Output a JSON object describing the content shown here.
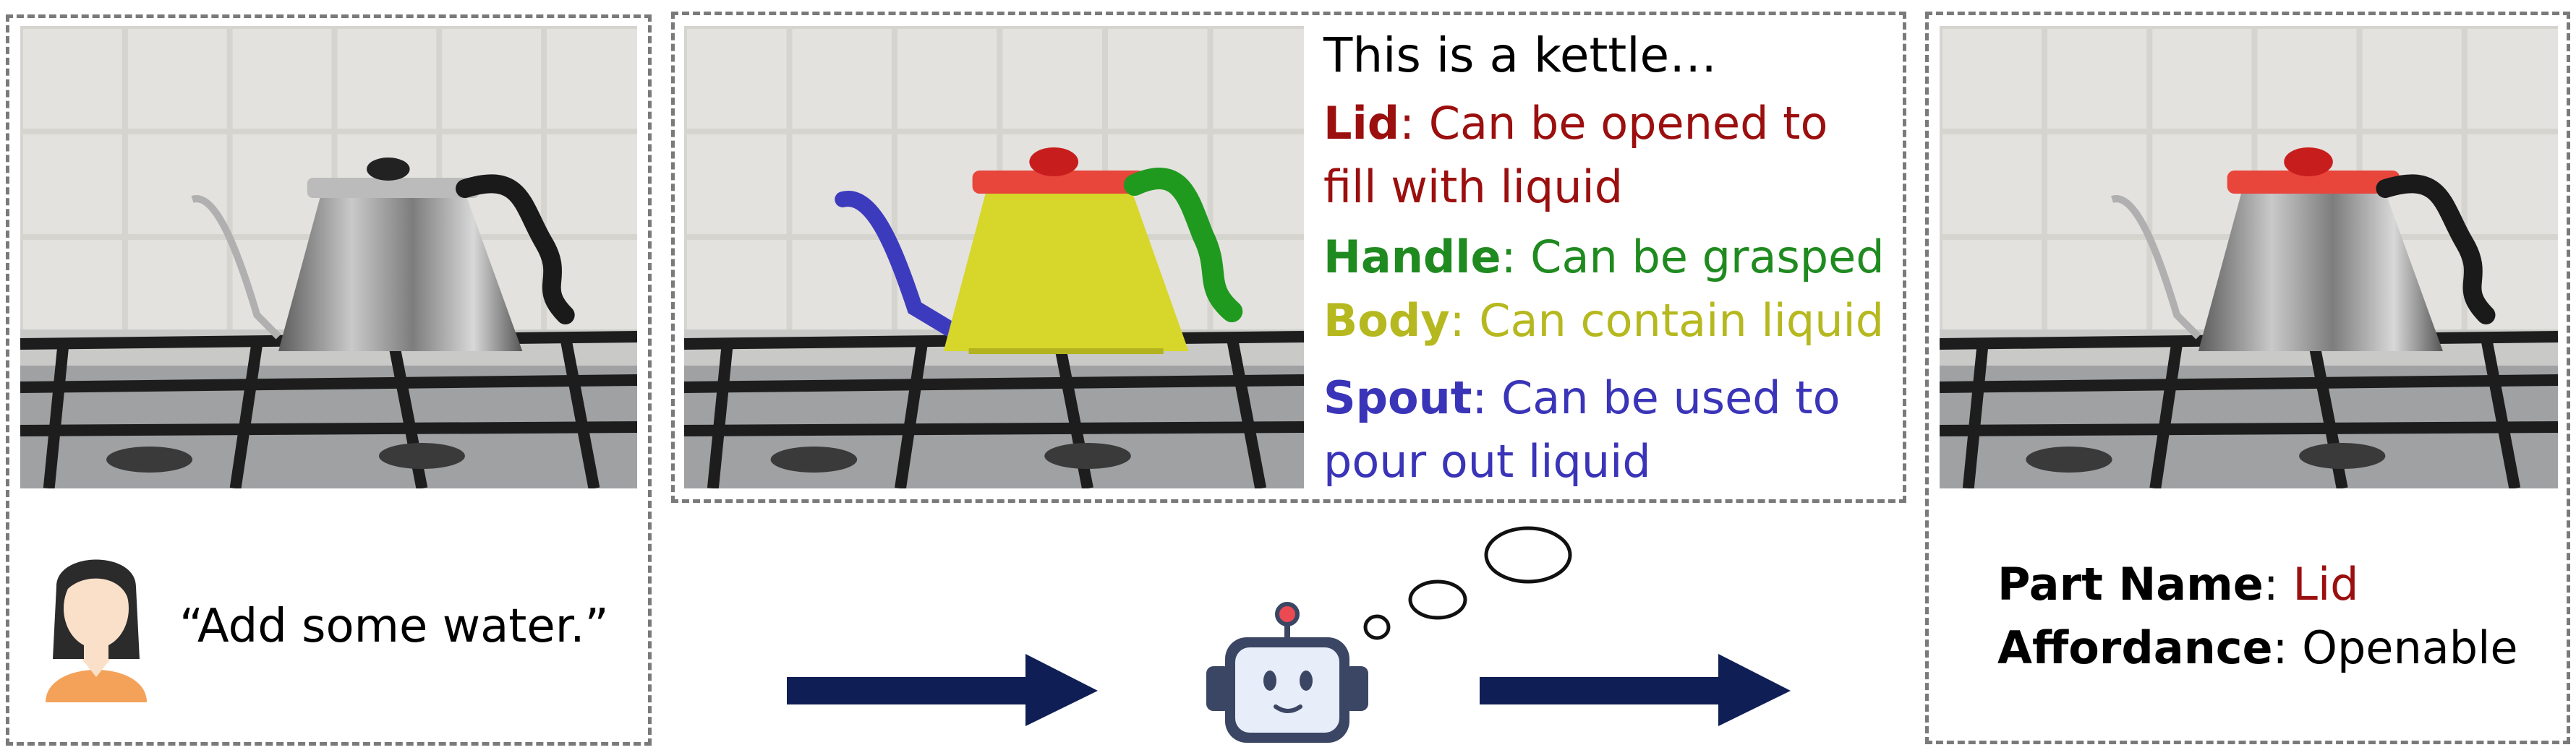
{
  "panel_left": {
    "instruction": "“Add some water.”",
    "avatar_icon": "person-avatar-icon"
  },
  "panel_middle": {
    "heading": "This is a kettle…",
    "parts": [
      {
        "name": "Lid",
        "desc_line1": ": Can be opened to",
        "desc_line2": "fill with liquid",
        "color": "#9b0f0f"
      },
      {
        "name": "Handle",
        "desc_line1": ": Can be grasped",
        "desc_line2": "",
        "color": "#1f8a1f"
      },
      {
        "name": "Body",
        "desc_line1": ": Can contain liquid",
        "desc_line2": "",
        "color": "#b6b81f"
      },
      {
        "name": "Spout",
        "desc_line1": ": Can be used to",
        "desc_line2": "pour out liquid",
        "color": "#3a34b8"
      }
    ]
  },
  "panel_right": {
    "part_label": "Part Name",
    "part_value": ": Lid",
    "affordance_label": "Affordance",
    "affordance_value": ": Openable"
  },
  "icons": {
    "robot": "robot-icon",
    "thought": "thought-bubble-icon",
    "arrow": "arrow-right-icon"
  },
  "colors": {
    "arrow": "#0f1f55",
    "lid_highlight": "#e8453b",
    "handle_highlight": "#1f9a1f",
    "body_highlight": "#d7d62a",
    "spout_highlight": "#3d3bbd",
    "part_value_red": "#9b0f0f"
  }
}
